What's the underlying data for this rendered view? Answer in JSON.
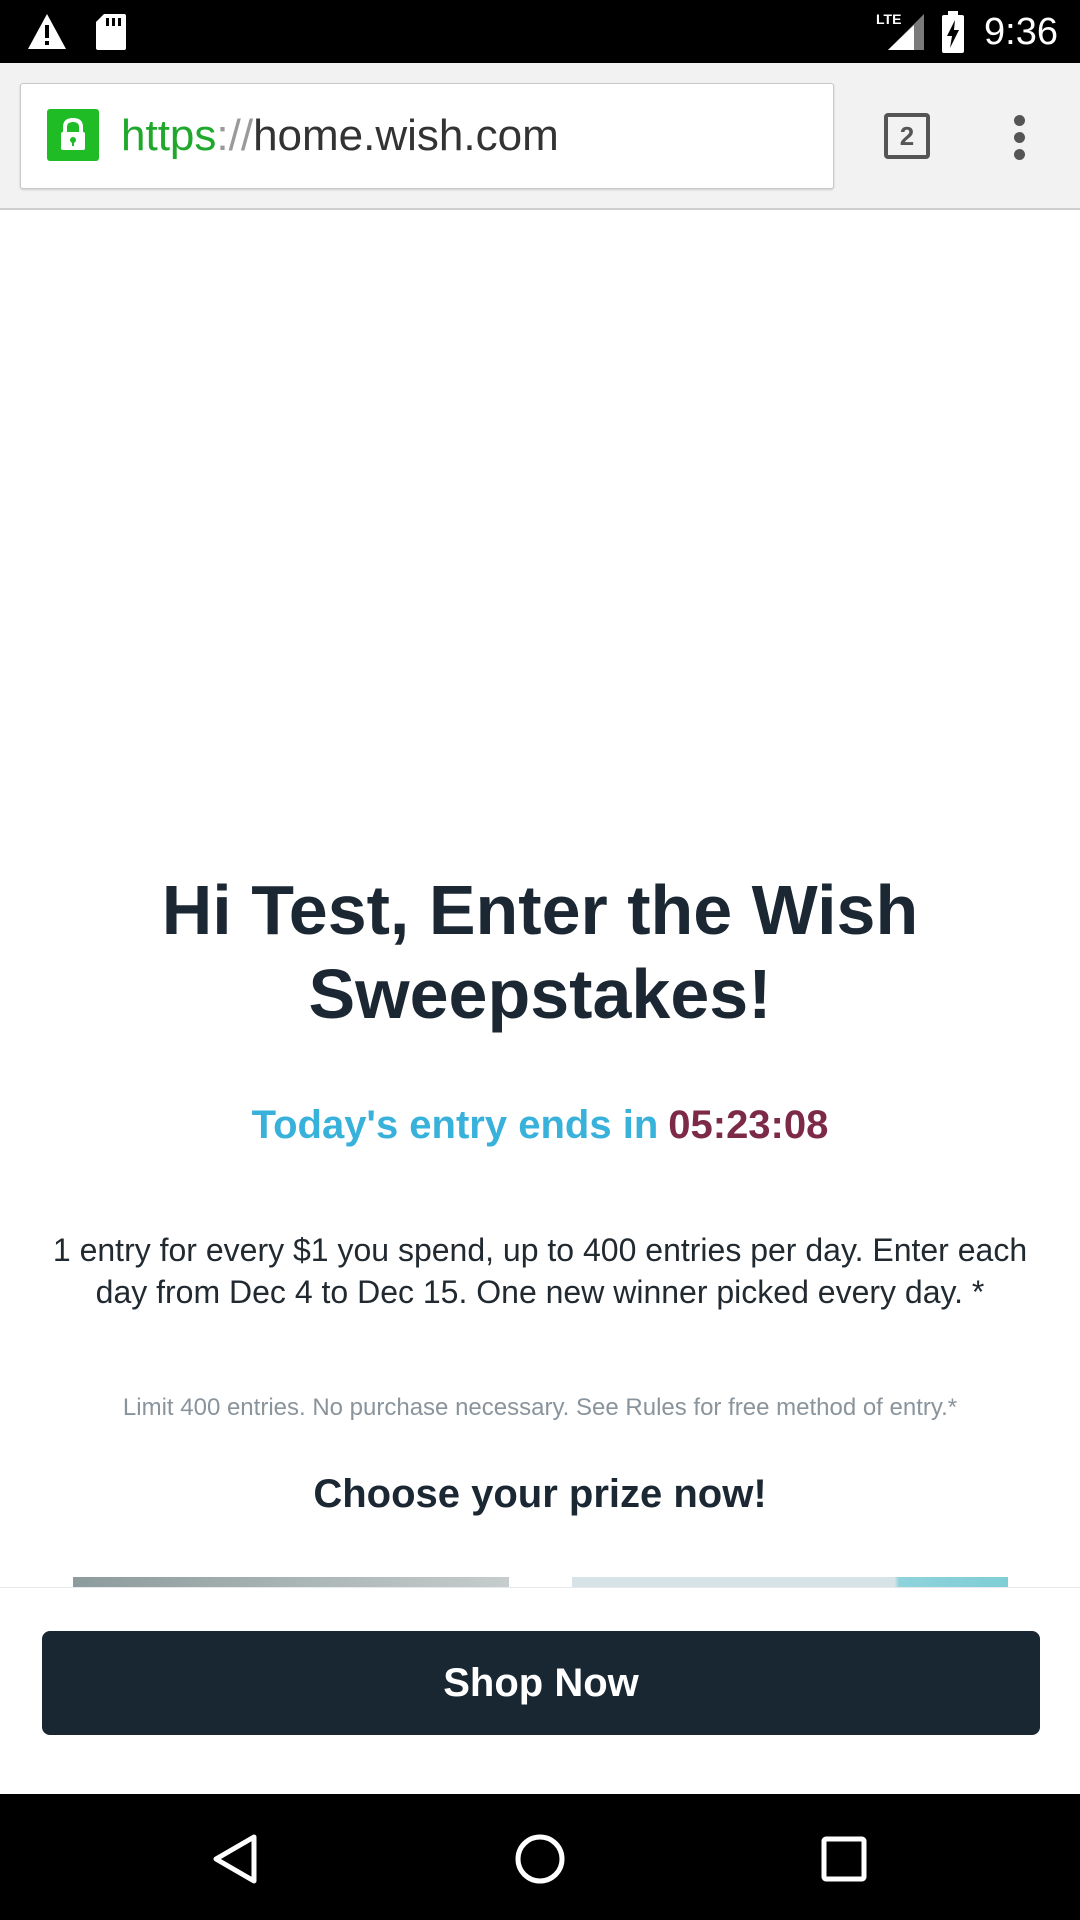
{
  "status_bar": {
    "time": "9:36",
    "network_label": "LTE",
    "icons": [
      "warning-icon",
      "sd-card-icon",
      "signal-icon",
      "battery-charging-icon"
    ]
  },
  "browser": {
    "url_scheme": "https",
    "url_separator": "://",
    "url_host": "home.wish.com",
    "tab_count": "2",
    "secure_color": "#1fbc26",
    "icons": [
      "lock-icon",
      "tab-switcher-icon",
      "overflow-menu-icon"
    ]
  },
  "page": {
    "headline": "Hi Test, Enter the Wish Sweepstakes!",
    "timer_label": "Today's entry ends in",
    "timer_value": "05:23:08",
    "description": "1 entry for every $1 you spend, up to 400 entries per day. Enter each day from Dec 4 to Dec 15. One new winner picked every day. *",
    "disclaimer": "Limit 400 entries. No purchase necessary. See Rules for free method of entry.*",
    "prize_heading": "Choose your prize now!",
    "colors": {
      "headline": "#1b2733",
      "timer_label": "#38b1db",
      "timer_value": "#7c2a48",
      "button_bg": "#192733"
    }
  },
  "cta": {
    "shop_now_label": "Shop Now"
  },
  "nav_bar": {
    "icons": [
      "back-icon",
      "home-icon",
      "recents-icon"
    ]
  }
}
